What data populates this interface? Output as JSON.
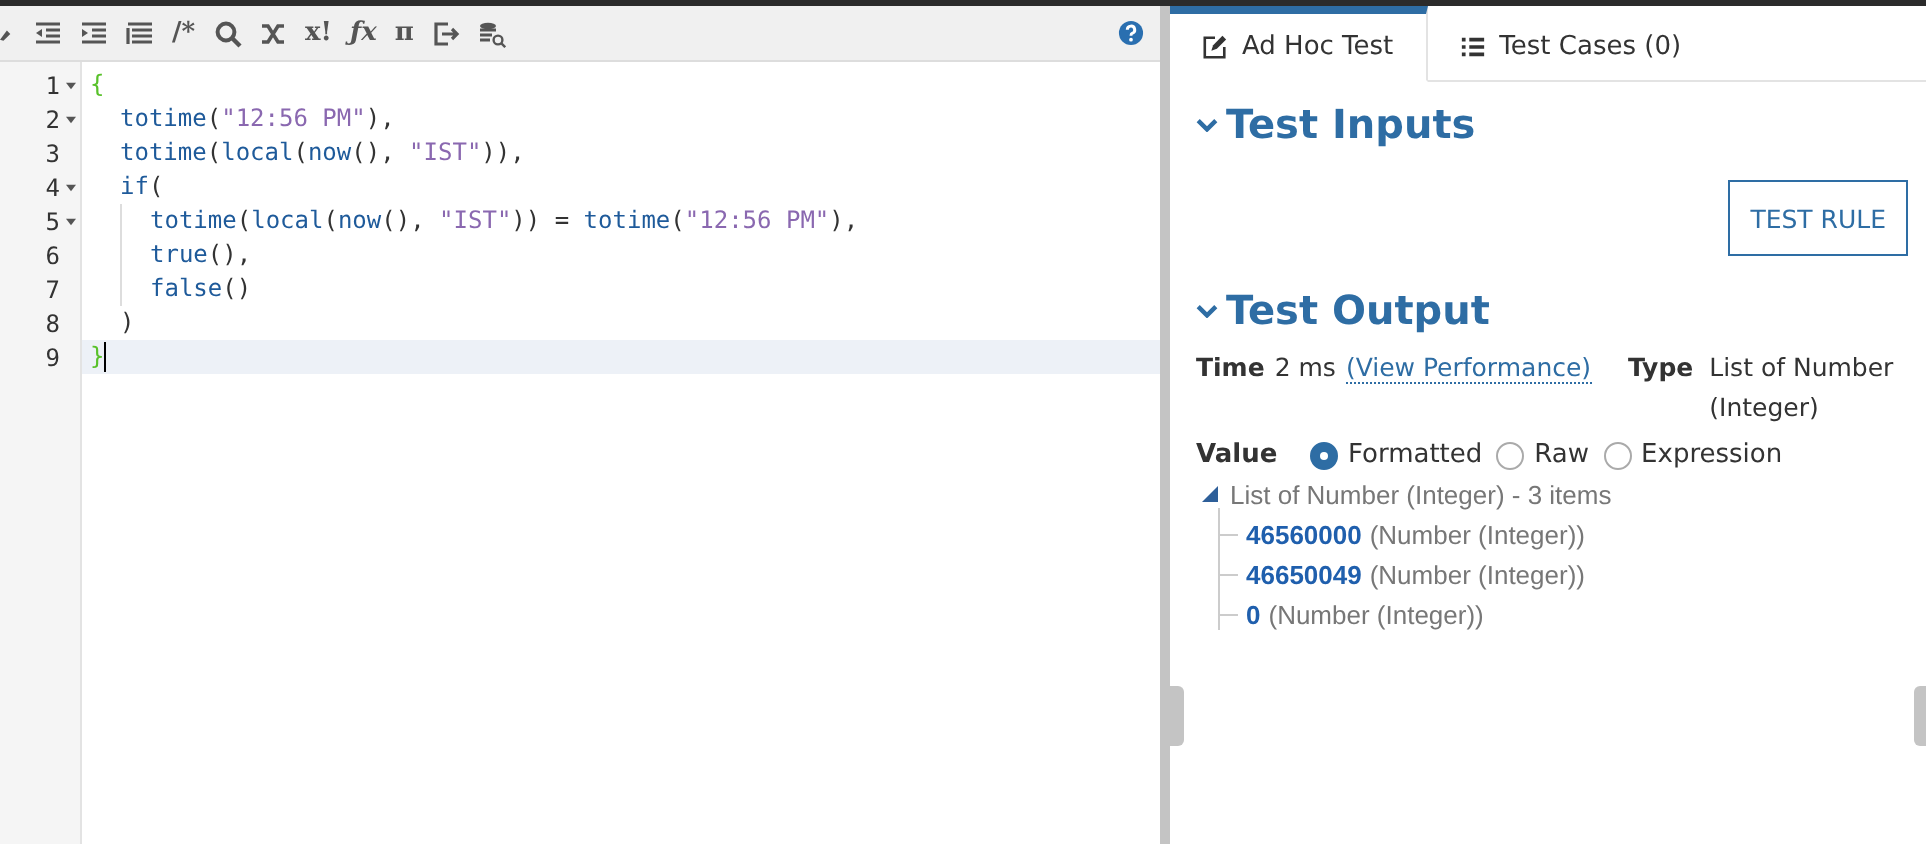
{
  "toolbar": {
    "glyphs": [
      "/*",
      "x!",
      "ƒx",
      "π"
    ]
  },
  "editor": {
    "lines": [
      {
        "number": "1",
        "foldable": true,
        "active": false,
        "tokens": [
          {
            "kind": "bracket",
            "text": "{"
          }
        ],
        "children": [
          {
            "number": "2",
            "foldable": true,
            "active": false,
            "tokens": [
              {
                "kind": "func",
                "text": "totime"
              },
              {
                "kind": "punct",
                "text": "("
              },
              {
                "kind": "str",
                "text": "\"12:56 PM\""
              },
              {
                "kind": "punct",
                "text": "),"
              }
            ]
          },
          {
            "number": "3",
            "foldable": false,
            "active": false,
            "tokens": [
              {
                "kind": "func",
                "text": "totime"
              },
              {
                "kind": "punct",
                "text": "("
              },
              {
                "kind": "func",
                "text": "local"
              },
              {
                "kind": "punct",
                "text": "("
              },
              {
                "kind": "func",
                "text": "now"
              },
              {
                "kind": "punct",
                "text": "(), "
              },
              {
                "kind": "str",
                "text": "\"IST\""
              },
              {
                "kind": "punct",
                "text": ")),"
              }
            ]
          },
          {
            "number": "4",
            "foldable": true,
            "active": false,
            "tokens": [
              {
                "kind": "func",
                "text": "if"
              },
              {
                "kind": "punct",
                "text": "("
              }
            ],
            "children": [
              {
                "number": "5",
                "foldable": true,
                "active": false,
                "tokens": [
                  {
                    "kind": "func",
                    "text": "totime"
                  },
                  {
                    "kind": "punct",
                    "text": "("
                  },
                  {
                    "kind": "func",
                    "text": "local"
                  },
                  {
                    "kind": "punct",
                    "text": "("
                  },
                  {
                    "kind": "func",
                    "text": "now"
                  },
                  {
                    "kind": "punct",
                    "text": "(), "
                  },
                  {
                    "kind": "str",
                    "text": "\"IST\""
                  },
                  {
                    "kind": "punct",
                    "text": ")) = "
                  },
                  {
                    "kind": "func",
                    "text": "totime"
                  },
                  {
                    "kind": "punct",
                    "text": "("
                  },
                  {
                    "kind": "str",
                    "text": "\"12:56 PM\""
                  },
                  {
                    "kind": "punct",
                    "text": "),"
                  }
                ]
              },
              {
                "number": "6",
                "foldable": false,
                "active": false,
                "tokens": [
                  {
                    "kind": "func",
                    "text": "true"
                  },
                  {
                    "kind": "punct",
                    "text": "(),"
                  }
                ]
              },
              {
                "number": "7",
                "foldable": false,
                "active": false,
                "tokens": [
                  {
                    "kind": "func",
                    "text": "false"
                  },
                  {
                    "kind": "punct",
                    "text": "()"
                  }
                ]
              }
            ]
          },
          {
            "number": "8",
            "foldable": false,
            "active": false,
            "tokens": [
              {
                "kind": "punct",
                "text": ")"
              }
            ]
          }
        ]
      },
      {
        "number": "9",
        "foldable": false,
        "active": true,
        "tokens": [
          {
            "kind": "bracket",
            "text": "}"
          }
        ]
      }
    ]
  },
  "tabs": [
    {
      "label": "Ad Hoc Test",
      "selected": true
    },
    {
      "label": "Test Cases (0)",
      "selected": false
    }
  ],
  "test_inputs": {
    "title": "Test Inputs",
    "expanded": true,
    "button": "TEST RULE"
  },
  "test_output": {
    "title": "Test Output",
    "expanded": true,
    "time_label": "Time",
    "time_value": "2 ms",
    "time_link": "(View Performance)",
    "type_label": "Type",
    "type_value": "List of Number (Integer)",
    "value_label": "Value",
    "formats": [
      {
        "label": "Formatted",
        "selected": true
      },
      {
        "label": "Raw",
        "selected": false
      },
      {
        "label": "Expression",
        "selected": false
      }
    ],
    "tree": {
      "label": "List of Number (Integer) - 3 items",
      "expanded": true,
      "children": [
        {
          "value": "46560000",
          "type": "(Number (Integer))"
        },
        {
          "value": "46650049",
          "type": "(Number (Integer))"
        },
        {
          "value": "0",
          "type": "(Number (Integer))"
        }
      ]
    }
  }
}
